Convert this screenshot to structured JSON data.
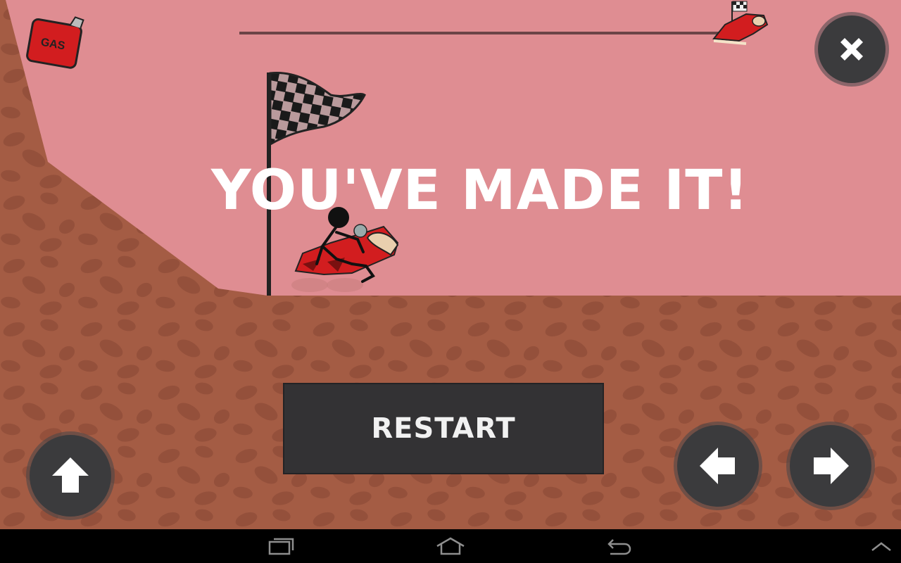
{
  "hud": {
    "gas_label": "GAS",
    "progress_fraction": 1.0
  },
  "finish": {
    "message": "YOU'VE MADE IT!"
  },
  "controls": {
    "restart_label": "RESTART",
    "close_icon": "close-icon",
    "accelerate_icon": "arrow-up-icon",
    "tilt_left_icon": "arrow-left-icon",
    "tilt_right_icon": "arrow-right-icon"
  },
  "navbar": {
    "recent_icon": "recent-apps-icon",
    "home_icon": "home-icon",
    "back_icon": "back-icon",
    "menu_icon": "chevron-up-icon"
  },
  "colors": {
    "sky": "#df8d92",
    "ground": "#a45c44",
    "button_bg": "#3b3b3d",
    "bike_red": "#d21d1f"
  }
}
